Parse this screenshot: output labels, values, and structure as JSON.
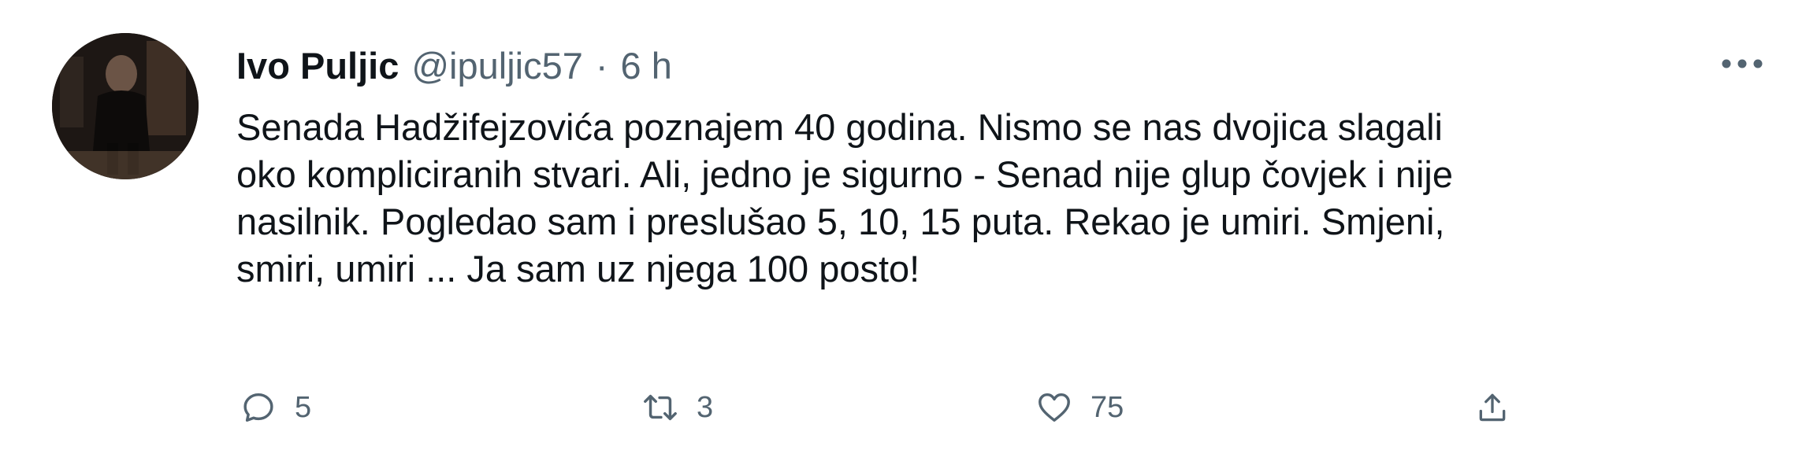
{
  "tweet": {
    "author_name": "Ivo Puljic",
    "author_handle": "@ipuljic57",
    "separator": "·",
    "time": "6 h",
    "text_lines": [
      "Senada Hadžifejzovića poznajem 40 godina. Nismo se nas dvojica slagali",
      "oko kompliciranih stvari. Ali, jedno je sigurno - Senad nije glup čovjek i nije",
      "nasilnik. Pogledao sam i preslušao 5, 10, 15 puta. Rekao je umiri. Smjeni,",
      "smiri, umiri ... Ja sam uz njega 100 posto!"
    ],
    "actions": {
      "reply": {
        "icon": "reply-icon",
        "count": "5"
      },
      "retweet": {
        "icon": "retweet-icon",
        "count": "3"
      },
      "like": {
        "icon": "heart-icon",
        "count": "75"
      },
      "share": {
        "icon": "share-icon"
      }
    },
    "more_icon": "more-icon"
  },
  "colors": {
    "text": "#0f1419",
    "secondary": "#536471",
    "background": "#ffffff"
  }
}
